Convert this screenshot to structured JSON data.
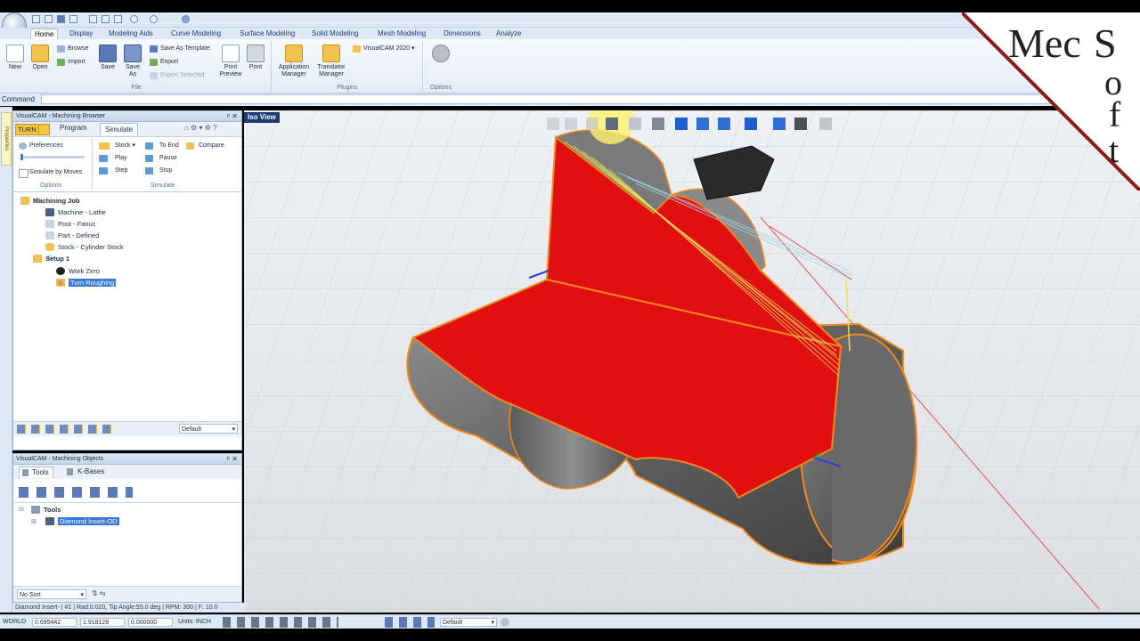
{
  "qat": {
    "icons": [
      "new-icon",
      "open-icon",
      "save-icon",
      "print-icon",
      "cut-icon",
      "copy-icon",
      "paste-icon",
      "undo-icon",
      "redo-icon",
      "refresh-icon"
    ]
  },
  "ribbon": {
    "tabs": [
      "Home",
      "Display",
      "Modeling Aids",
      "Curve Modeling",
      "Surface Modeling",
      "Solid Modeling",
      "Mesh Modeling",
      "Dimensions",
      "Analyze"
    ],
    "file_group": {
      "label": "File",
      "new": "New",
      "open": "Open",
      "browse": "Browse",
      "import": "Import",
      "save": "Save",
      "save_as": "Save\nAs",
      "save_as_template": "Save As Template",
      "export": "Export",
      "export_selected": "Export Selected",
      "print_preview": "Print\nPreview",
      "print": "Print"
    },
    "plugins_group": {
      "label": "Plugins",
      "app_manager": "Application\nManager",
      "translator_manager": "Translator\nManager",
      "visualcam": "VisualCAM 2020"
    },
    "options_group": {
      "label": "Options"
    }
  },
  "command": {
    "label": "Command",
    "value": ""
  },
  "left_strip": {
    "properties_tab": "Properties"
  },
  "browser": {
    "title": "VisualCAM - Machining Browser",
    "tabs": {
      "turn": "TURN",
      "program": "Program",
      "simulate": "Simulate"
    },
    "sim": {
      "preferences": "Preferences",
      "simulate_by_moves": "Simulate by Moves",
      "options_label": "Options",
      "stock": "Stock",
      "play": "Play",
      "step": "Step",
      "to_end": "To End",
      "pause": "Pause",
      "stop": "Stop",
      "compare": "Compare",
      "simulate_label": "Simulate"
    },
    "tree": [
      {
        "label": "Machining Job",
        "bold": true
      },
      {
        "label": "Machine - Lathe"
      },
      {
        "label": "Post - Fanuc"
      },
      {
        "label": "Part - Defined"
      },
      {
        "label": "Stock - Cylinder Stock"
      },
      {
        "label": "Setup 1",
        "bold": true
      },
      {
        "label": "Work Zero"
      },
      {
        "label": "Turn Roughing",
        "selected": true
      }
    ],
    "bottom_select": "Default"
  },
  "objects": {
    "title": "VisualCAM - Machining Objects",
    "tabs": {
      "tools": "Tools",
      "kbases": "K-Bases"
    },
    "tree": [
      {
        "label": "Tools",
        "bold": true
      },
      {
        "label": "Diamond Insert-OD",
        "selected": true
      }
    ],
    "sort": "No Sort"
  },
  "viewport": {
    "view_label": "Iso View"
  },
  "status": {
    "tool_info": "Diamond Insert- | #1 | Rad:0.020, Tip Angle:55.0 deg | RPM: 300 | F: 10.0",
    "coord_system": "WORLD",
    "x": "0.695442",
    "y": "1.918128",
    "z": "0.000000",
    "units": "Units: INCH",
    "layer": "Default"
  },
  "watermark": {
    "text": "MecSoft",
    "letters": [
      "M",
      "e",
      "c",
      "S",
      "o",
      "f",
      "t"
    ]
  },
  "colors": {
    "ribbon_bg": "#e3ecf7",
    "accent": "#1f3c72",
    "part_red": "#e01010",
    "edge_orange": "#f08a1c"
  }
}
